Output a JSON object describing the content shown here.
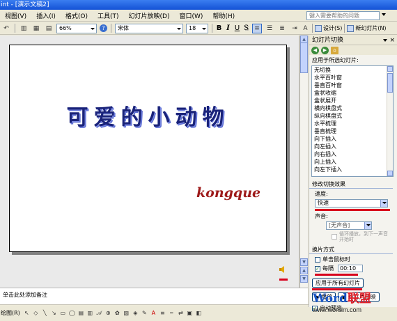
{
  "window": {
    "title": "int - [演示文稿2]"
  },
  "menu": {
    "items": [
      "视图(V)",
      "插入(I)",
      "格式(O)",
      "工具(T)",
      "幻灯片放映(D)",
      "窗口(W)",
      "帮助(H)"
    ],
    "help_placeholder": "键入需要帮助的问题"
  },
  "toolbar": {
    "zoom": "66%",
    "font": "宋体",
    "font_size": "18",
    "bold": "B",
    "italic": "I",
    "underline": "U",
    "shadow": "S",
    "design_label": "设计(S)",
    "new_slide_label": "新幻灯片(N)"
  },
  "slide": {
    "title": "可爱的小动物",
    "text": "kongque"
  },
  "task_pane": {
    "title": "幻灯片切换",
    "apply_to_selected_label": "应用于所选幻灯片:",
    "transitions": [
      "无切换",
      "水平百叶窗",
      "垂直百叶窗",
      "盒状收缩",
      "盒状展开",
      "横向棋盘式",
      "纵向棋盘式",
      "水平梳理",
      "垂直梳理",
      "向下插入",
      "向左插入",
      "向右插入",
      "向上插入",
      "向左下插入"
    ],
    "modify_section": "修改切换效果",
    "speed_label": "速度:",
    "speed_value": "快速",
    "sound_label": "声音:",
    "sound_value": "[无声音]",
    "loop_label": "循环播放，到下一声音开始时",
    "advance_section": "换片方式",
    "on_click_label": "单击鼠标时",
    "every_label": "每隔",
    "every_value": "00:10",
    "apply_all_label": "应用于所有幻灯片",
    "play_label": "播放",
    "slideshow_label": "幻灯片放映",
    "autopreview_label": "自动预览"
  },
  "notes": {
    "placeholder": "单击此处添加备注"
  },
  "drawbar": {
    "draw_label": "绘图(R)"
  },
  "watermark": {
    "brand_a": "Word",
    "brand_b": "联盟",
    "url": "www.wordlm.com"
  },
  "colors": {
    "title_bar": "#1452d6",
    "accent_red": "#d8001c",
    "slide_title": "#1a237a",
    "slide_text": "#9e1b1b"
  }
}
